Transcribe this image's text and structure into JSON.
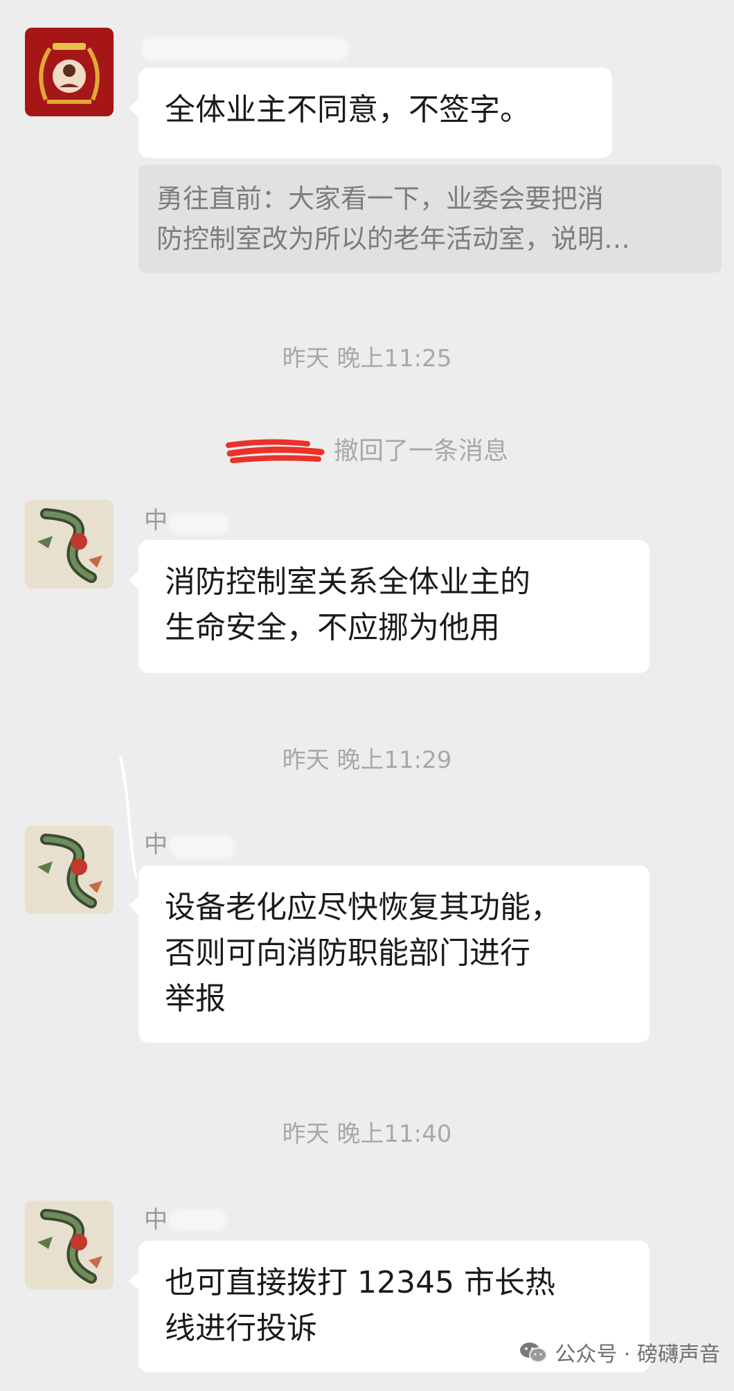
{
  "messages": [
    {
      "quote_lines": [
        "勇往直前：大家看一下，业委会要把消",
        "防控制室改为所以的老年活动室，说明…"
      ],
      "lines": [
        "全体业主不同意，不签字。"
      ]
    },
    {
      "lines": [
        "消防控制室关系全体业主的",
        "生命安全，不应挪为他用"
      ]
    },
    {
      "lines": [
        "设备老化应尽快恢复其功能，",
        "否则可向消防职能部门进行",
        "举报"
      ]
    },
    {
      "name_visible": "中",
      "lines": [
        "也可直接拨打 12345 市长热",
        "线进行投诉"
      ]
    }
  ],
  "timestamps": [
    "昨天 晚上11:25",
    "昨天 晚上11:29",
    "昨天 晚上11:40"
  ],
  "system_message": "撤回了一条消息",
  "watermark": {
    "text": "公众号 · 磅礴声音",
    "icon": "wechat-icon"
  },
  "colors": {
    "background": "#ededed",
    "bubble": "#ffffff",
    "quote_bg": "#e1e1e1",
    "redaction": "#e8322a"
  }
}
